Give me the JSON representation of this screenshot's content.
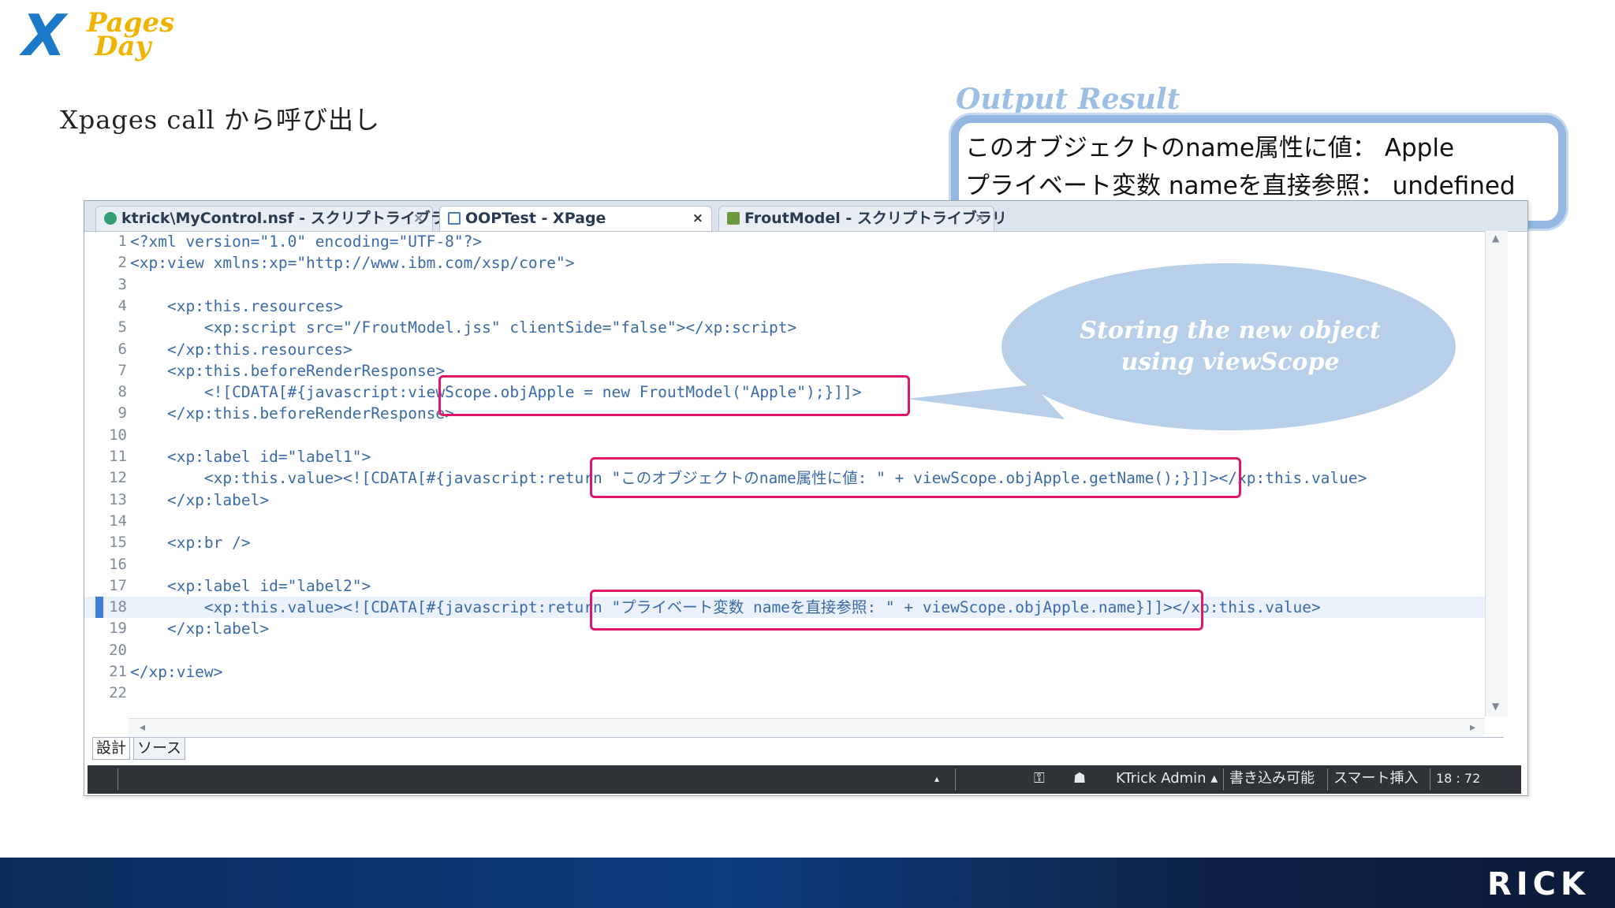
{
  "slide": {
    "logo_x": "X",
    "logo_word1": "Pages",
    "logo_word2": "Day",
    "title": "Xpages call から呼び出し",
    "brand": "RICK"
  },
  "output": {
    "heading": "Output Result",
    "line1": "このオブジェクトのname属性に値： Apple",
    "line2": "プライベート変数 nameを直接参照： undefined"
  },
  "callout": {
    "text": "Storing the new object using viewScope"
  },
  "editor": {
    "tabs": [
      {
        "label": "ktrick\\MyControl.nsf - スクリプトライブラリ",
        "close": "×",
        "icon": "script-library-icon"
      },
      {
        "label": "OOPTest - XPage",
        "close": "×",
        "icon": "xpage-icon"
      },
      {
        "label": "FroutModel - スクリプトライブラリ",
        "close": "×",
        "icon": "script-library-icon"
      }
    ],
    "lines": [
      {
        "n": "1",
        "t": "<?xml version=\"1.0\" encoding=\"UTF-8\"?>"
      },
      {
        "n": "2",
        "t": "<xp:view xmlns:xp=\"http://www.ibm.com/xsp/core\">"
      },
      {
        "n": "3",
        "t": ""
      },
      {
        "n": "4",
        "t": "    <xp:this.resources>"
      },
      {
        "n": "5",
        "t": "        <xp:script src=\"/FroutModel.jss\" clientSide=\"false\"></xp:script>"
      },
      {
        "n": "6",
        "t": "    </xp:this.resources>"
      },
      {
        "n": "7",
        "t": "    <xp:this.beforeRenderResponse>"
      },
      {
        "n": "8",
        "t": "        <![CDATA[#{javascript:viewScope.objApple = new FroutModel(\"Apple\");}]]>"
      },
      {
        "n": "9",
        "t": "    </xp:this.beforeRenderResponse>"
      },
      {
        "n": "10",
        "t": ""
      },
      {
        "n": "11",
        "t": "    <xp:label id=\"label1\">"
      },
      {
        "n": "12",
        "t": "        <xp:this.value><![CDATA[#{javascript:return \"このオブジェクトのname属性に値: \" + viewScope.objApple.getName();}]]></xp:this.value>"
      },
      {
        "n": "13",
        "t": "    </xp:label>"
      },
      {
        "n": "14",
        "t": ""
      },
      {
        "n": "15",
        "t": "    <xp:br />"
      },
      {
        "n": "16",
        "t": ""
      },
      {
        "n": "17",
        "t": "    <xp:label id=\"label2\">"
      },
      {
        "n": "18",
        "t": "        <xp:this.value><![CDATA[#{javascript:return \"プライベート変数 nameを直接参照: \" + viewScope.objApple.name}]]></xp:this.value>"
      },
      {
        "n": "19",
        "t": "    </xp:label>"
      },
      {
        "n": "20",
        "t": ""
      },
      {
        "n": "21",
        "t": "</xp:view>"
      },
      {
        "n": "22",
        "t": ""
      }
    ],
    "current_line": "18",
    "view_tabs": {
      "design": "設計",
      "source": "ソース"
    },
    "status": {
      "user": "KTrick Admin ▴",
      "mode": "書き込み可能",
      "insert": "スマート挿入",
      "position": "18 : 72"
    }
  },
  "colors": {
    "highlight": "#e0166b",
    "callout_fill": "#b7cfe8",
    "output_border": "#93b7e0",
    "brand_band": "#0d3d7e"
  }
}
